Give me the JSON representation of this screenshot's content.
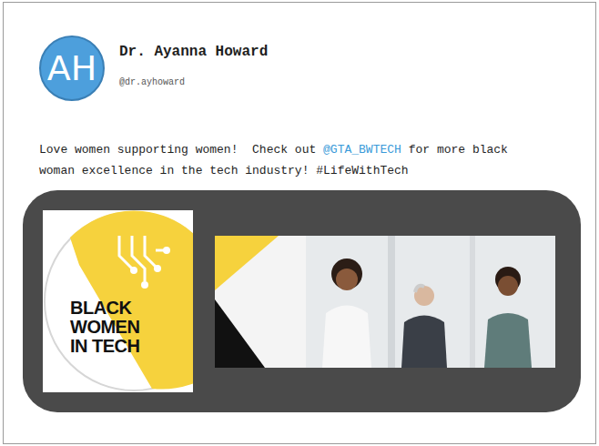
{
  "author": {
    "initials": "AH",
    "name": "Dr. Ayanna Howard",
    "handle": "@dr.ayhoward"
  },
  "post": {
    "segments": [
      {
        "text": "Love women supporting women!  Check out ",
        "kind": "plain"
      },
      {
        "text": "@GTA_BWTECH",
        "kind": "mention"
      },
      {
        "text": " for more black woman excellence in the tech industry! #LifeWithTech",
        "kind": "plain"
      }
    ]
  },
  "media": {
    "logo": {
      "lines": [
        "BLACK",
        "WOMEN",
        "IN TECH"
      ]
    }
  }
}
